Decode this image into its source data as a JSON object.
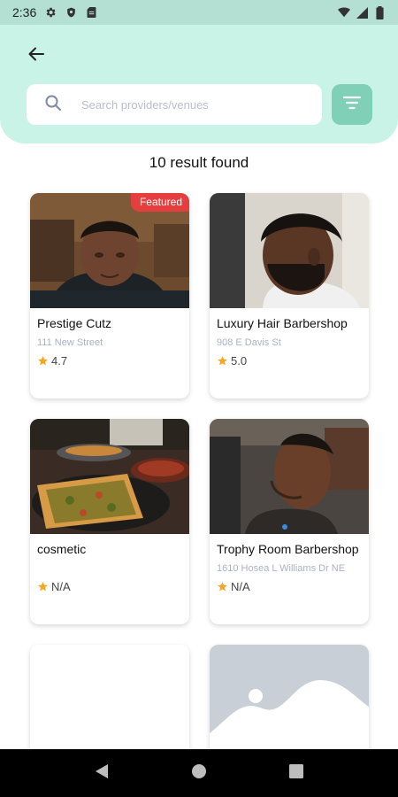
{
  "status_bar": {
    "time": "2:36",
    "icons": [
      "gear-icon",
      "shield-icon",
      "sim-card-icon",
      "wifi-icon",
      "signal-icon",
      "battery-icon"
    ]
  },
  "header": {
    "back_icon": "arrow-left-icon",
    "search": {
      "placeholder": "Search providers/venues",
      "value": ""
    },
    "filter_icon": "filter-lines-icon"
  },
  "results": {
    "count_text": "10 result found"
  },
  "providers": [
    {
      "name": "Prestige Cutz",
      "address": "111 New Street",
      "rating": "4.7",
      "featured": true,
      "badge": "Featured"
    },
    {
      "name": "Luxury Hair Barbershop",
      "address": "908 E Davis St",
      "rating": "5.0",
      "featured": false
    },
    {
      "name": "cosmetic",
      "address": "",
      "rating": "N/A",
      "featured": false
    },
    {
      "name": "Trophy Room Barbershop",
      "address": "1610 Hosea L Williams Dr NE",
      "rating": "N/A",
      "featured": false
    }
  ],
  "colors": {
    "status_bar": "#b3e0d3",
    "header_bg": "#c9f3e6",
    "filter_button": "#7fd0b6",
    "featured_badge": "#e53e3e",
    "star": "#f5a623",
    "address_text": "#a9b2c3"
  },
  "nav_bar": {
    "icons": [
      "back-triangle-icon",
      "home-circle-icon",
      "recents-square-icon"
    ]
  }
}
